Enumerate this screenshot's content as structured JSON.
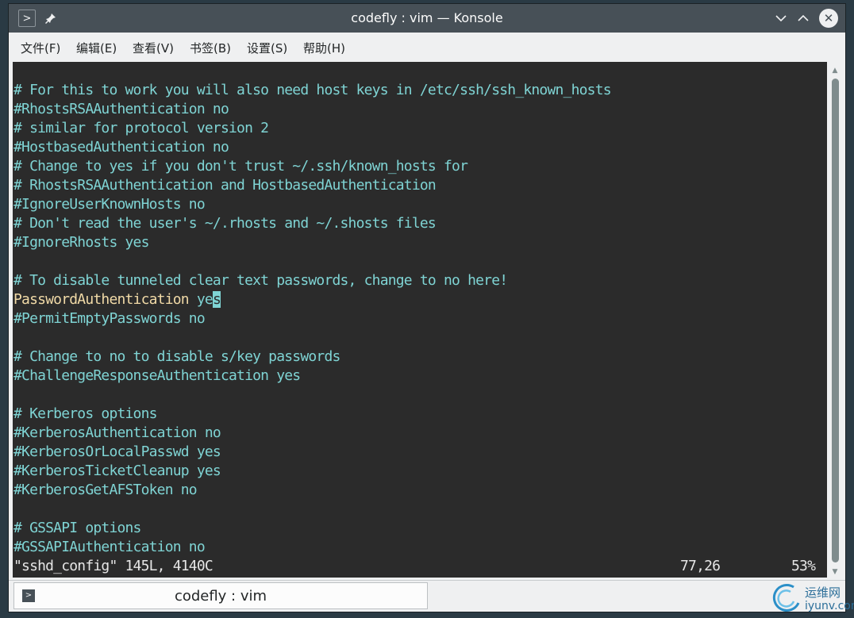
{
  "window": {
    "title": "codefly : vim — Konsole"
  },
  "titlebar": {
    "menu_icon": "terminal-prompt-icon",
    "pin_icon": "pin-icon",
    "minimize_icon": "chevron-down-icon",
    "maximize_icon": "chevron-up-icon",
    "close_icon": "close-icon"
  },
  "menubar": {
    "items": [
      "文件(F)",
      "编辑(E)",
      "查看(V)",
      "书签(B)",
      "设置(S)",
      "帮助(H)"
    ]
  },
  "terminal": {
    "colors": {
      "background": "#2b2b2b",
      "comment": "#7fd4d4",
      "keyword": "#f1daa7",
      "status": "#e6e6e6"
    },
    "lines": [
      "",
      "# For this to work you will also need host keys in /etc/ssh/ssh_known_hosts",
      "#RhostsRSAAuthentication no",
      "# similar for protocol version 2",
      "#HostbasedAuthentication no",
      "# Change to yes if you don't trust ~/.ssh/known_hosts for",
      "# RhostsRSAAuthentication and HostbasedAuthentication",
      "#IgnoreUserKnownHosts no",
      "# Don't read the user's ~/.rhosts and ~/.shosts files",
      "#IgnoreRhosts yes",
      "",
      "# To disable tunneled clear text passwords, change to no here!",
      "",
      "#PermitEmptyPasswords no",
      "",
      "# Change to no to disable s/key passwords",
      "#ChallengeResponseAuthentication yes",
      "",
      "# Kerberos options",
      "#KerberosAuthentication no",
      "#KerberosOrLocalPasswd yes",
      "#KerberosTicketCleanup yes",
      "#KerberosGetAFSToken no",
      "",
      "# GSSAPI options",
      "#GSSAPIAuthentication no"
    ],
    "active_line": {
      "keyword": "PasswordAuthentication",
      "value_before_cursor": " ye",
      "cursor_char": "s"
    },
    "status": {
      "file_info": "\"sshd_config\" 145L, 4140C",
      "position": "77,26",
      "percent": "53%"
    }
  },
  "tabbar": {
    "tab_label": "codefly : vim",
    "tab_icon": "terminal-prompt-icon"
  },
  "watermark": {
    "text_cn": "运维网",
    "text_en": "iyunv.com"
  }
}
